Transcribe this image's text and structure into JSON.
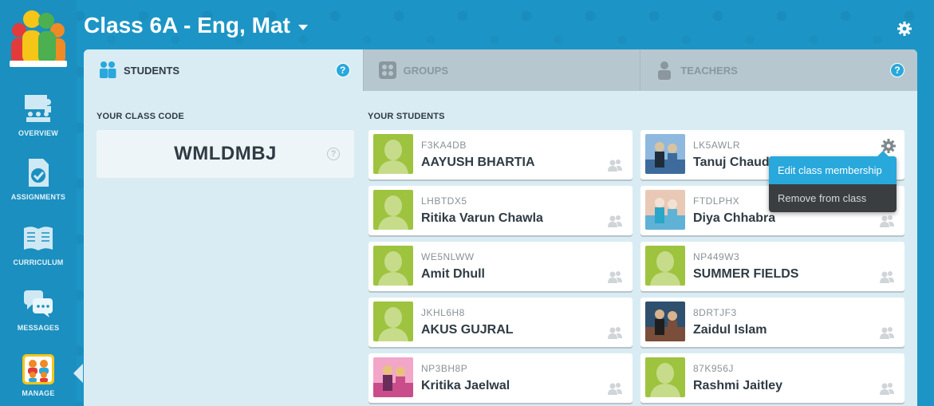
{
  "header": {
    "class_title": "Class 6A - Eng, Mat"
  },
  "sidebar": {
    "items": [
      {
        "label": "OVERVIEW",
        "icon": "presentation-icon"
      },
      {
        "label": "ASSIGNMENTS",
        "icon": "assignment-check-icon"
      },
      {
        "label": "CURRICULUM",
        "icon": "book-icon"
      },
      {
        "label": "MESSAGES",
        "icon": "chat-bubbles-icon"
      },
      {
        "label": "MANAGE",
        "icon": "class-people-icon",
        "active": true
      }
    ]
  },
  "tabs": [
    {
      "label": "STUDENTS",
      "icon": "students-icon",
      "active": true,
      "help": "?"
    },
    {
      "label": "GROUPS",
      "icon": "groups-icon",
      "active": false
    },
    {
      "label": "TEACHERS",
      "icon": "teacher-icon",
      "active": false,
      "help": "?"
    }
  ],
  "class_code": {
    "label": "YOUR CLASS CODE",
    "code": "WMLDMBJ",
    "help": "?"
  },
  "students_label": "YOUR STUDENTS",
  "students": [
    {
      "id": "F3KA4DB",
      "name": "AAYUSH BHARTIA",
      "avatar": "placeholder"
    },
    {
      "id": "LK5AWLR",
      "name": "Tanuj Chaudhary",
      "avatar": "photo"
    },
    {
      "id": "LHBTDX5",
      "name": "Ritika Varun Chawla",
      "avatar": "placeholder"
    },
    {
      "id": "FTDLPHX",
      "name": "Diya Chhabra",
      "avatar": "photo"
    },
    {
      "id": "WE5NLWW",
      "name": "Amit Dhull",
      "avatar": "placeholder"
    },
    {
      "id": "NP449W3",
      "name": "SUMMER FIELDS",
      "avatar": "placeholder"
    },
    {
      "id": "JKHL6H8",
      "name": "AKUS GUJRAL",
      "avatar": "placeholder"
    },
    {
      "id": "8DRTJF3",
      "name": "Zaidul Islam",
      "avatar": "photo"
    },
    {
      "id": "NP3BH8P",
      "name": "Kritika Jaelwal",
      "avatar": "photo"
    },
    {
      "id": "87K956J",
      "name": "Rashmi Jaitley",
      "avatar": "placeholder"
    }
  ],
  "context_menu": {
    "items": [
      "Edit class membership",
      "Remove from class"
    ]
  },
  "colors": {
    "accent": "#29a8dc",
    "background": "#1c95c6",
    "avatar_green": "#9ec33f"
  }
}
